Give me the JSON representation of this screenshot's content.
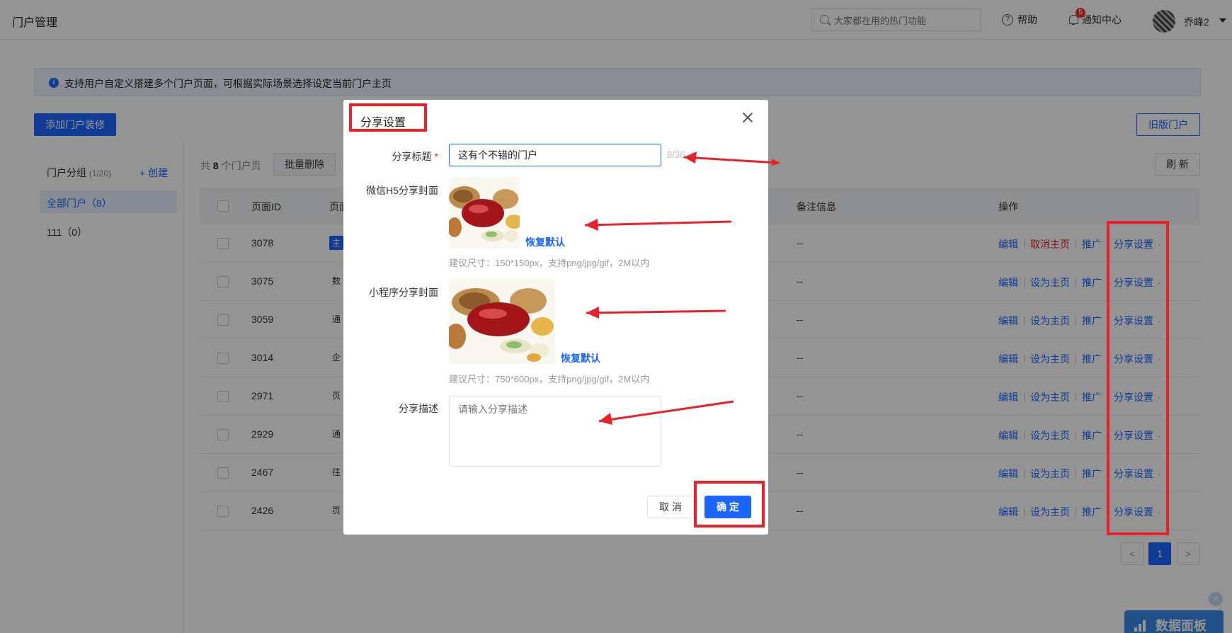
{
  "header": {
    "title": "门户管理",
    "search_placeholder": "大家都在用的热门功能",
    "help_label": "帮助",
    "notification_label": "通知中心",
    "notification_count": "5",
    "username": "乔峰2"
  },
  "info": {
    "text": "支持用户自定义搭建多个门户页面，可根据实际场景选择设定当前门户主页"
  },
  "toolbar": {
    "add_button": "添加门户装修",
    "old_portal_button": "旧版门户",
    "refresh_button": "刷 新",
    "batch_delete_button": "批量删除",
    "total_prefix": "共",
    "total_count": "8",
    "total_suffix": "个门户页"
  },
  "groups": {
    "title": "门户分组",
    "count": "(1/20)",
    "create_label": "+ 创建",
    "items": [
      {
        "label": "全部门户（8）"
      },
      {
        "label": "111（0）"
      }
    ]
  },
  "table": {
    "headers": {
      "id": "页面ID",
      "name": "页面",
      "remark": "备注信息",
      "actions": "操作"
    },
    "rows": [
      {
        "id": "3078",
        "name": "主页",
        "remark": "--",
        "action2": "取消主页"
      },
      {
        "id": "3075",
        "name": "数据",
        "remark": "--",
        "action2": "设为主页"
      },
      {
        "id": "3059",
        "name": "通用",
        "remark": "--",
        "action2": "设为主页"
      },
      {
        "id": "3014",
        "name": "企业",
        "remark": "--",
        "action2": "设为主页"
      },
      {
        "id": "2971",
        "name": "页面",
        "remark": "--",
        "action2": "设为主页"
      },
      {
        "id": "2929",
        "name": "通用",
        "remark": "--",
        "action2": "设为主页"
      },
      {
        "id": "2467",
        "name": "往期",
        "remark": "--",
        "action2": "设为主页"
      },
      {
        "id": "2426",
        "name": "页面",
        "remark": "--",
        "action2": "设为主页"
      }
    ],
    "action_edit": "编辑",
    "action_promote": "推广",
    "action_share": "分享设置"
  },
  "pagination": {
    "prev": "<",
    "current": "1",
    "next": ">"
  },
  "data_panel": {
    "label": "数据面板"
  },
  "modal": {
    "title": "分享设置",
    "share_title_label": "分享标题",
    "share_title_value": "这有个不错的门户",
    "share_title_counter": "8/36",
    "h5_cover_label": "微信H5分享封面",
    "h5_restore": "恢复默认",
    "h5_hint": "建议尺寸：150*150px，支持png/jpg/gif，2M以内",
    "mini_cover_label": "小程序分享封面",
    "mini_restore": "恢复默认",
    "mini_hint": "建议尺寸：750*600px，支持png/jpg/gif，2M以内",
    "desc_label": "分享描述",
    "desc_placeholder": "请输入分享描述",
    "cancel": "取 消",
    "confirm": "确 定"
  },
  "colors": {
    "accent": "#1a66ff",
    "annotation_red": "#e8222b",
    "danger": "#e02020"
  }
}
